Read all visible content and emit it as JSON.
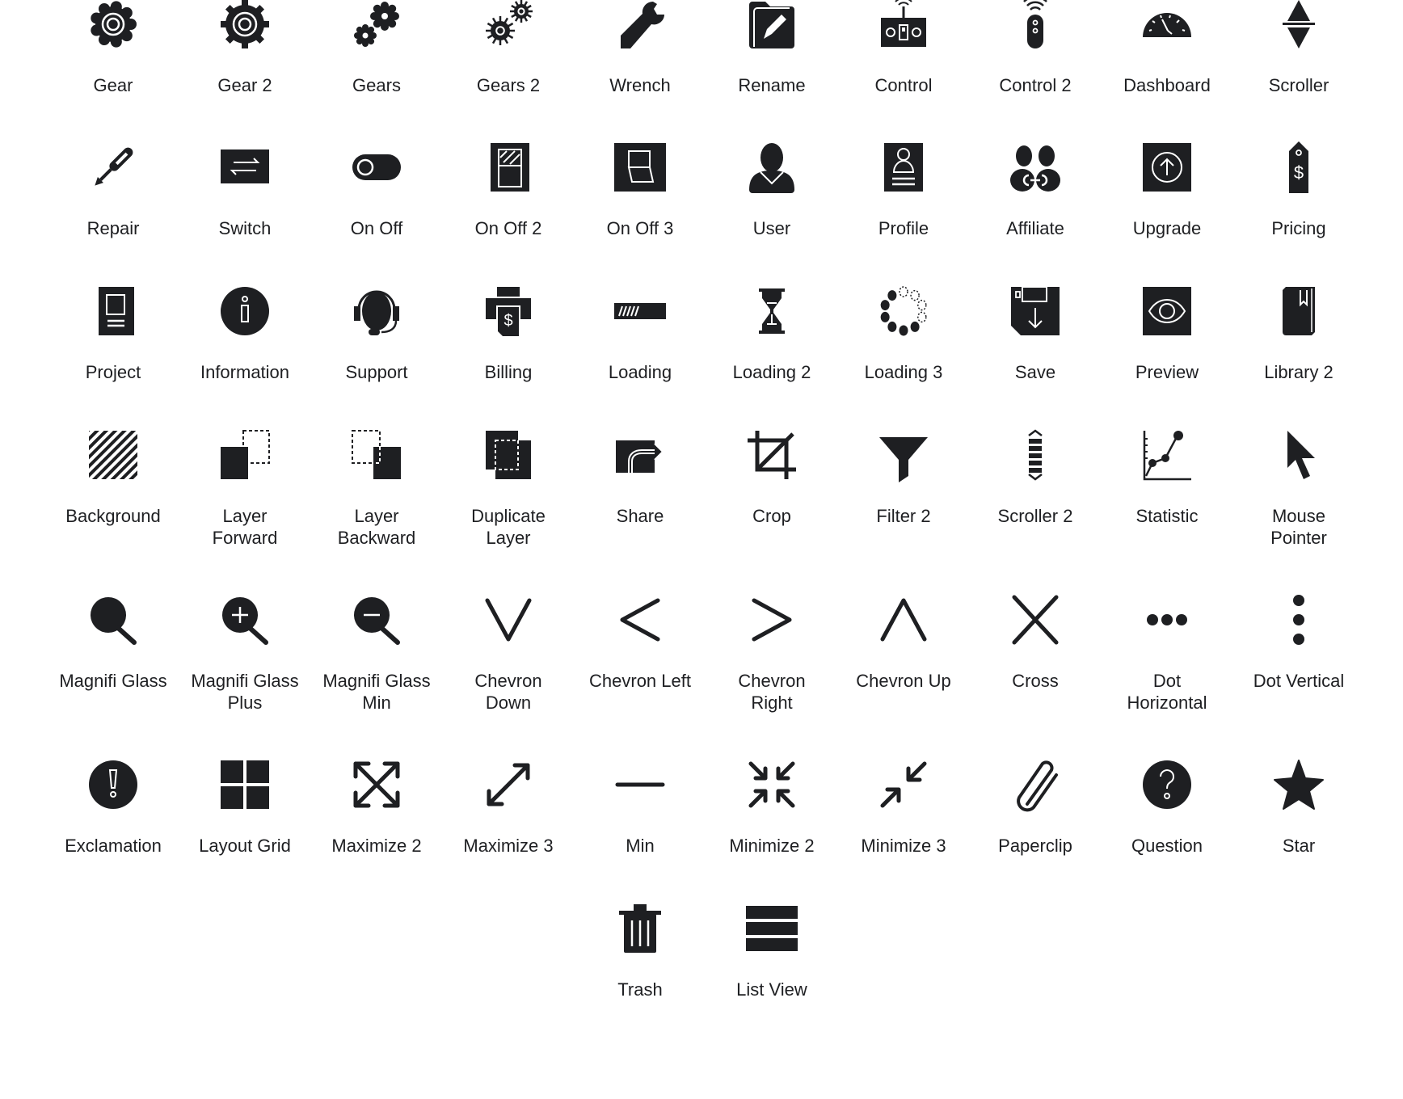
{
  "colors": {
    "icon": "#1e1f22",
    "background": "#ffffff"
  },
  "icons": [
    {
      "label": "Gear",
      "icon": "gear-icon"
    },
    {
      "label": "Gear 2",
      "icon": "gear-2-icon"
    },
    {
      "label": "Gears",
      "icon": "gears-icon"
    },
    {
      "label": "Gears 2",
      "icon": "gears-2-icon"
    },
    {
      "label": "Wrench",
      "icon": "wrench-icon"
    },
    {
      "label": "Rename",
      "icon": "rename-icon"
    },
    {
      "label": "Control",
      "icon": "control-icon"
    },
    {
      "label": "Control 2",
      "icon": "control-2-icon"
    },
    {
      "label": "Dashboard",
      "icon": "dashboard-icon"
    },
    {
      "label": "Scroller",
      "icon": "scroller-icon"
    },
    {
      "label": "Repair",
      "icon": "repair-icon"
    },
    {
      "label": "Switch",
      "icon": "switch-icon"
    },
    {
      "label": "On Off",
      "icon": "on-off-icon"
    },
    {
      "label": "On Off 2",
      "icon": "on-off-2-icon"
    },
    {
      "label": "On Off 3",
      "icon": "on-off-3-icon"
    },
    {
      "label": "User",
      "icon": "user-icon"
    },
    {
      "label": "Profile",
      "icon": "profile-icon"
    },
    {
      "label": "Affiliate",
      "icon": "affiliate-icon"
    },
    {
      "label": "Upgrade",
      "icon": "upgrade-icon"
    },
    {
      "label": "Pricing",
      "icon": "pricing-icon"
    },
    {
      "label": "Project",
      "icon": "project-icon"
    },
    {
      "label": "Information",
      "icon": "information-icon"
    },
    {
      "label": "Support",
      "icon": "support-icon"
    },
    {
      "label": "Billing",
      "icon": "billing-icon"
    },
    {
      "label": "Loading",
      "icon": "loading-icon"
    },
    {
      "label": "Loading 2",
      "icon": "loading-2-icon"
    },
    {
      "label": "Loading 3",
      "icon": "loading-3-icon"
    },
    {
      "label": "Save",
      "icon": "save-icon"
    },
    {
      "label": "Preview",
      "icon": "preview-icon"
    },
    {
      "label": "Library 2",
      "icon": "library-2-icon"
    },
    {
      "label": "Background",
      "icon": "background-icon"
    },
    {
      "label": "Layer\nForward",
      "icon": "layer-forward-icon"
    },
    {
      "label": "Layer\nBackward",
      "icon": "layer-backward-icon"
    },
    {
      "label": "Duplicate\nLayer",
      "icon": "duplicate-layer-icon"
    },
    {
      "label": "Share",
      "icon": "share-icon"
    },
    {
      "label": "Crop",
      "icon": "crop-icon"
    },
    {
      "label": "Filter 2",
      "icon": "filter-2-icon"
    },
    {
      "label": "Scroller 2",
      "icon": "scroller-2-icon"
    },
    {
      "label": "Statistic",
      "icon": "statistic-icon"
    },
    {
      "label": "Mouse\nPointer",
      "icon": "mouse-pointer-icon"
    },
    {
      "label": "Magnifi Glass",
      "icon": "magnifying-glass-icon"
    },
    {
      "label": "Magnifi Glass\nPlus",
      "icon": "magnifying-glass-plus-icon"
    },
    {
      "label": "Magnifi Glass\nMin",
      "icon": "magnifying-glass-minus-icon"
    },
    {
      "label": "Chevron\nDown",
      "icon": "chevron-down-icon"
    },
    {
      "label": "Chevron Left",
      "icon": "chevron-left-icon"
    },
    {
      "label": "Chevron\nRight",
      "icon": "chevron-right-icon"
    },
    {
      "label": "Chevron Up",
      "icon": "chevron-up-icon"
    },
    {
      "label": "Cross",
      "icon": "cross-icon"
    },
    {
      "label": "Dot\nHorizontal",
      "icon": "dot-horizontal-icon"
    },
    {
      "label": "Dot Vertical",
      "icon": "dot-vertical-icon"
    },
    {
      "label": "Exclamation",
      "icon": "exclamation-icon"
    },
    {
      "label": "Layout Grid",
      "icon": "layout-grid-icon"
    },
    {
      "label": "Maximize 2",
      "icon": "maximize-2-icon"
    },
    {
      "label": "Maximize 3",
      "icon": "maximize-3-icon"
    },
    {
      "label": "Min",
      "icon": "minimize-line-icon"
    },
    {
      "label": "Minimize 2",
      "icon": "minimize-2-icon"
    },
    {
      "label": "Minimize 3",
      "icon": "minimize-3-icon"
    },
    {
      "label": "Paperclip",
      "icon": "paperclip-icon"
    },
    {
      "label": "Question",
      "icon": "question-icon"
    },
    {
      "label": "Star",
      "icon": "star-icon"
    },
    {
      "label": "Trash",
      "icon": "trash-icon"
    },
    {
      "label": "List View",
      "icon": "list-view-icon"
    }
  ]
}
